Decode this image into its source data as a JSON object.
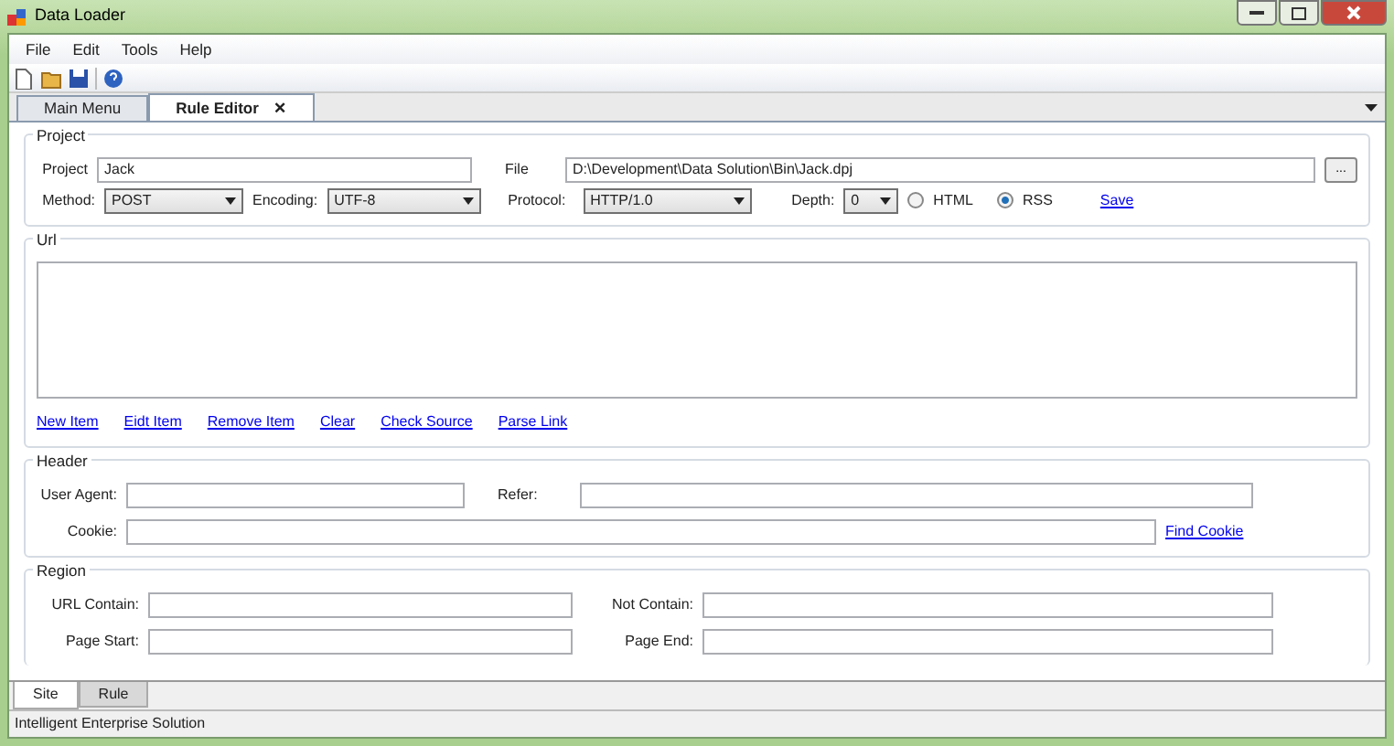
{
  "window": {
    "title": "Data Loader"
  },
  "menu": [
    "File",
    "Edit",
    "Tools",
    "Help"
  ],
  "toolbar": [
    {
      "kind": "new"
    },
    {
      "kind": "open"
    },
    {
      "kind": "save"
    },
    {
      "kind": "help"
    }
  ],
  "doc_tabs": [
    {
      "label": "Main Menu",
      "selected": false
    },
    {
      "label": "Rule Editor",
      "selected": true,
      "close": "✕"
    }
  ],
  "project": {
    "title": "Project",
    "project_label": "Project",
    "project_value": "Jack",
    "file_label": "File",
    "file_value": "D:\\Development\\Data Solution\\Bin\\Jack.dpj",
    "browse": "...",
    "method_label": "Method:",
    "method_value": "POST",
    "encoding_label": "Encoding:",
    "encoding_value": "UTF-8",
    "protocol_label": "Protocol:",
    "protocol_value": "HTTP/1.0",
    "depth_label": "Depth:",
    "depth_value": "0",
    "formats": [
      {
        "label": "HTML",
        "selected": false
      },
      {
        "label": "RSS",
        "selected": true
      }
    ],
    "save": "Save"
  },
  "url": {
    "title": "Url",
    "links": [
      "New Item",
      "Eidt Item",
      "Remove Item",
      "Clear",
      "Check Source",
      "Parse Link"
    ]
  },
  "header": {
    "title": "Header",
    "user_agent_label": "User Agent:",
    "refer_label": "Refer:",
    "cookie_label": "Cookie:",
    "find_cookie": "Find Cookie"
  },
  "region": {
    "title": "Region",
    "url_contain_label": "URL Contain:",
    "not_contain_label": "Not Contain:",
    "page_start_label": "Page Start:",
    "page_end_label": "Page End:"
  },
  "bottom_tabs": [
    {
      "label": "Site",
      "selected": true
    },
    {
      "label": "Rule",
      "selected": false
    }
  ],
  "status_bar": "Intelligent Enterprise Solution"
}
